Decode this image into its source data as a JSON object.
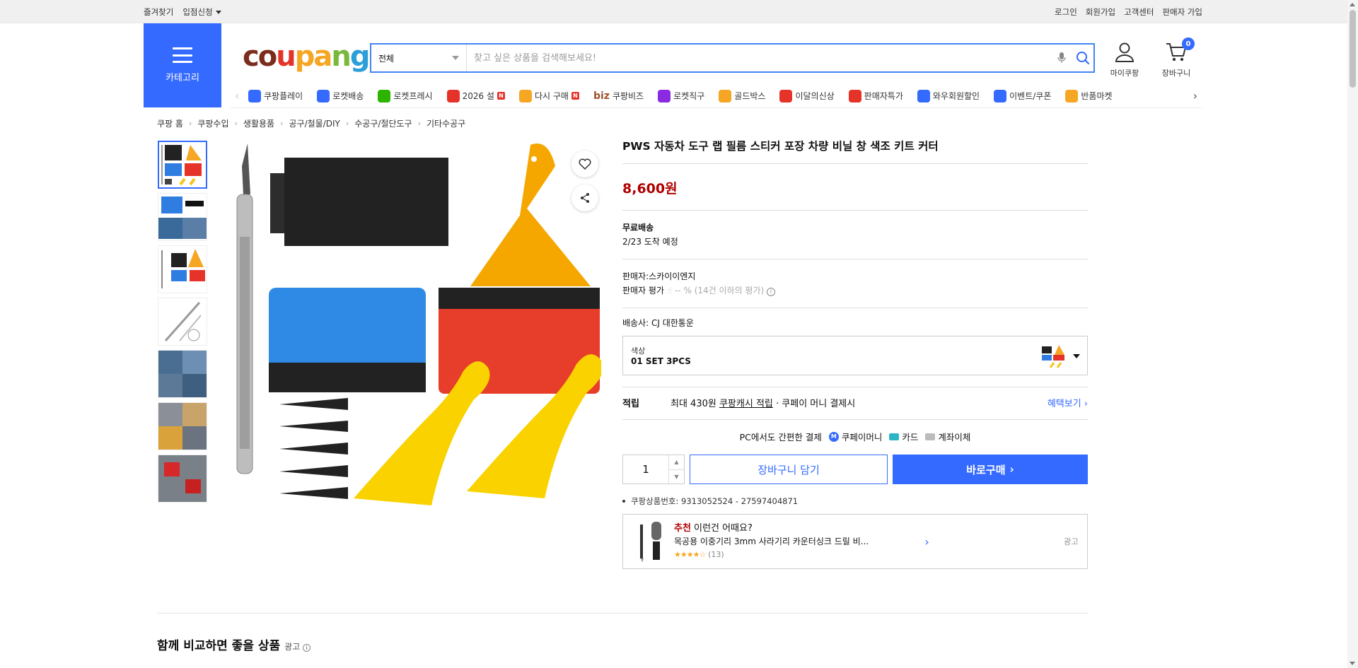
{
  "topbar": {
    "left": [
      "즐겨찾기",
      "입점신청"
    ],
    "right": [
      "로그인",
      "회원가입",
      "고객센터",
      "판매자 가입"
    ]
  },
  "header": {
    "category_label": "카테고리",
    "logo": {
      "c": "c",
      "o": "o",
      "u": "u",
      "p": "p",
      "a": "a",
      "n": "n",
      "g": "g"
    },
    "search": {
      "scope": "전체",
      "placeholder": "찾고 싶은 상품을 검색해보세요!"
    },
    "mypage_label": "마이쿠팡",
    "cart_label": "장바구니",
    "cart_count": "0"
  },
  "nav": [
    {
      "label": "쿠팡플레이",
      "color": "#346aff"
    },
    {
      "label": "로켓배송",
      "color": "#346aff"
    },
    {
      "label": "로켓프레시",
      "color": "#2db400"
    },
    {
      "label": "2026 설",
      "color": "#e5332a",
      "badge": "N"
    },
    {
      "label": "다시 구매",
      "color": "#f5a623",
      "badge": "N"
    },
    {
      "label": "쿠팡비즈",
      "color": "#a0522d",
      "prefix": "biz"
    },
    {
      "label": "로켓직구",
      "color": "#8a2be2"
    },
    {
      "label": "골드박스",
      "color": "#f5a623"
    },
    {
      "label": "이달의신상",
      "color": "#e5332a"
    },
    {
      "label": "판매자특가",
      "color": "#e5332a"
    },
    {
      "label": "와우회원할인",
      "color": "#346aff"
    },
    {
      "label": "이벤트/쿠폰",
      "color": "#346aff"
    },
    {
      "label": "반품마켓",
      "color": "#f5a623"
    }
  ],
  "breadcrumb": [
    "쿠팡 홈",
    "쿠팡수입",
    "생활용품",
    "공구/철물/DIY",
    "수공구/절단도구",
    "기타수공구"
  ],
  "product": {
    "title": "PWS 자동차 도구 랩 필름 스티커 포장 차량 비닐 창 색조 키트 커터",
    "price": "8,600원",
    "shipping_label": "무료배송",
    "arrival": "2/23 도착 예정",
    "seller": "판매자:스카이이엔지",
    "seller_rating_label": "판매자 평가",
    "seller_rating_value": "-- %",
    "seller_rating_note": "(14건 이하의 평가)",
    "carrier": "배송사:  CJ 대한통운",
    "option_label": "색상",
    "option_value": "01 SET 3PCS",
    "reward_label": "적립",
    "reward_prefix": "최대 430원 ",
    "reward_link": "쿠팡캐시 적립",
    "reward_suffix": " · 쿠페이 머니 결제시",
    "reward_more": "혜택보기",
    "pay_title": "PC에서도 간편한 결제",
    "pay_methods": [
      "쿠페이머니",
      "카드",
      "계좌이체"
    ],
    "quantity": "1",
    "cart_button": "장바구니 담기",
    "buy_button": "바로구매",
    "product_no": "쿠팡상품번호: 9313052524 - 27597404871"
  },
  "recommend": {
    "head_highlight": "추천",
    "head_rest": " 이런건 어때요?",
    "name": "목공용 이중기리 3mm 사라기리 카운터싱크 드릴 비...",
    "stars": "★★★★☆",
    "reviews": "(13)",
    "ad": "광고"
  },
  "compare": {
    "title": "함께 비교하면 좋을 상품",
    "ad": "광고"
  }
}
